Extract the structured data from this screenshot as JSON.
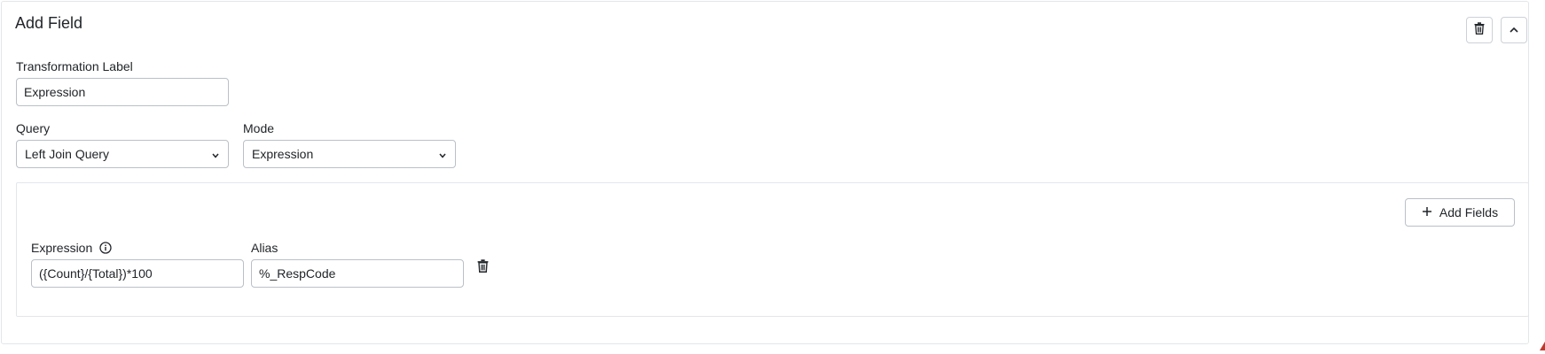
{
  "panel": {
    "title": "Add Field"
  },
  "transformation": {
    "label": "Transformation Label",
    "value": "Expression"
  },
  "query": {
    "label": "Query",
    "selected": "Left Join Query"
  },
  "mode": {
    "label": "Mode",
    "selected": "Expression"
  },
  "fields_section": {
    "add_button_label": "Add Fields",
    "rows": [
      {
        "expression_label": "Expression",
        "expression_value": "({Count}/{Total})*100",
        "alias_label": "Alias",
        "alias_value": "%_RespCode"
      }
    ]
  },
  "colors": {
    "border": "#b9c0c7",
    "panel_border": "#e3e6ea",
    "text": "#212529"
  }
}
